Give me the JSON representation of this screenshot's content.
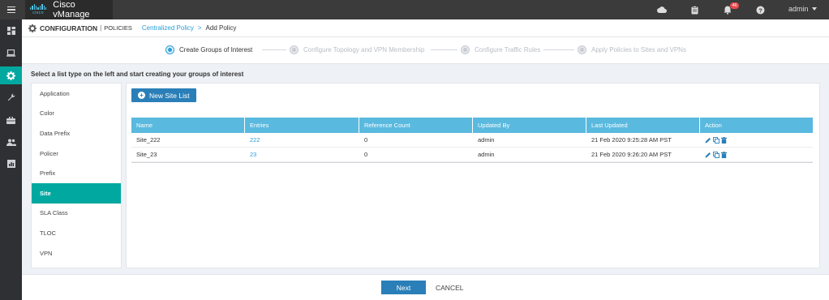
{
  "header": {
    "logo_text": "cisco",
    "app_name": "Cisco vManage",
    "notification_count": "46",
    "user": "admin"
  },
  "breadcrumb": {
    "section": "CONFIGURATION",
    "subsection": "POLICIES",
    "parent": "Centralized Policy",
    "separator": ">",
    "current": "Add Policy"
  },
  "stepper": {
    "steps": [
      {
        "label": "Create Groups of Interest",
        "active": true
      },
      {
        "label": "Configure Topology and VPN Membership",
        "active": false
      },
      {
        "label": "Configure Traffic Rules",
        "active": false
      },
      {
        "label": "Apply Policies to Sites and VPNs",
        "active": false
      }
    ]
  },
  "instruction": "Select a list type on the left and start creating your groups of interest",
  "list_types": [
    {
      "label": "Application"
    },
    {
      "label": "Color"
    },
    {
      "label": "Data Prefix"
    },
    {
      "label": "Policer"
    },
    {
      "label": "Prefix"
    },
    {
      "label": "Site",
      "selected": true
    },
    {
      "label": "SLA Class"
    },
    {
      "label": "TLOC"
    },
    {
      "label": "VPN"
    }
  ],
  "new_button": "New Site List",
  "table": {
    "columns": [
      "Name",
      "Entries",
      "Reference Count",
      "Updated By",
      "Last Updated",
      "Action"
    ],
    "rows": [
      {
        "name": "Site_222",
        "entries": "222",
        "reference_count": "0",
        "updated_by": "admin",
        "last_updated": "21 Feb 2020 9:25:28 AM PST"
      },
      {
        "name": "Site_23",
        "entries": "23",
        "reference_count": "0",
        "updated_by": "admin",
        "last_updated": "21 Feb 2020 9:26:20 AM PST"
      }
    ]
  },
  "footer": {
    "next_label": "Next",
    "cancel_label": "CANCEL"
  },
  "colors": {
    "accent": "#00a8a0",
    "primary_button": "#2a7fb8",
    "table_header": "#5ab9de",
    "link": "#2a9fd6",
    "topbar": "#3b3b3b"
  }
}
